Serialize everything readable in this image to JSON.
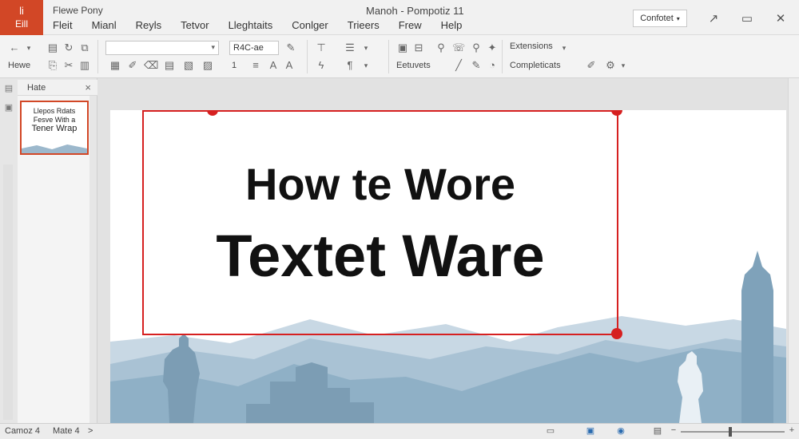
{
  "app": {
    "badge_top": "li",
    "file_tab": "Eill",
    "document_name": "Flewe Pony",
    "window_title": "Manoh - Pompotiz 11",
    "share_label": "Confotet",
    "accent": "#d24726"
  },
  "menu": [
    {
      "label": "Fleit"
    },
    {
      "label": "Mianl"
    },
    {
      "label": "Reyls"
    },
    {
      "label": "Tetvor"
    },
    {
      "label": "Lleghtaits"
    },
    {
      "label": "Conlger"
    },
    {
      "label": "Trieers"
    },
    {
      "label": "Frew"
    },
    {
      "label": "Help"
    }
  ],
  "ribbon": {
    "row2_left_label": "Hewe",
    "font_size_value": "R4C-ae",
    "size_row2_value": "1",
    "group_label_1": "Extensions",
    "group_label_2": "Completicats",
    "text_label": "Eetuvets"
  },
  "pane": {
    "title": "Hate",
    "close_glyph": "×"
  },
  "thumbnail": {
    "line1": "Llepos Rdats",
    "line2": "Fesve With a",
    "line3": "Tener Wrap"
  },
  "slide": {
    "title_line1": "How te Wore",
    "title_line2": "Textet  Ware",
    "selection_color": "#d62020",
    "scene_color": "#8fb0c6"
  },
  "status": {
    "left_text": "Camoz 4",
    "page_text": "Mate 4",
    "arrow": ">"
  }
}
